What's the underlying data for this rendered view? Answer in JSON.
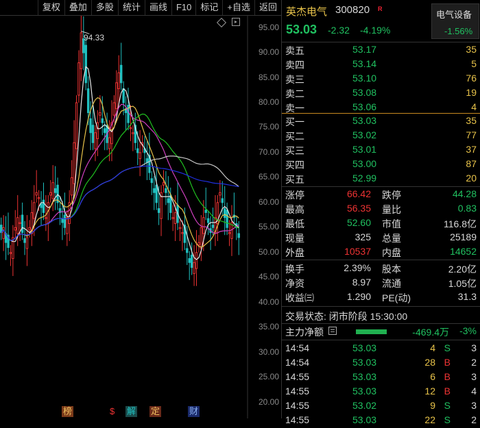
{
  "toolbar": {
    "buttons": [
      "复权",
      "叠加",
      "多股",
      "统计",
      "画线",
      "F10",
      "标记",
      "+自选",
      "返回"
    ]
  },
  "chart": {
    "y_ticks": [
      "95.00",
      "90.00",
      "85.00",
      "80.00",
      "75.00",
      "70.00",
      "65.00",
      "60.00",
      "55.00",
      "50.00",
      "45.00",
      "40.00",
      "35.00",
      "30.00",
      "25.00",
      "20.00"
    ],
    "peak_label": "94.33",
    "badges": [
      "榜",
      "$",
      "解",
      "定",
      "财"
    ],
    "colors": {
      "up": "#ee3333",
      "down": "#20c0c0",
      "ma5": "#e8e8e8",
      "ma10": "#e8c34a",
      "ma20": "#d040c0",
      "ma30": "#20c020",
      "ma60": "#c8c8c8",
      "ma120": "#2030e0"
    }
  },
  "chart_data": {
    "type": "candlestick",
    "ylim": [
      20,
      97
    ],
    "peak": 94.33,
    "series": [
      {
        "values": [
          54,
          55,
          52,
          51,
          50,
          53,
          55,
          57,
          56,
          54,
          52,
          53,
          55,
          58,
          60,
          62,
          61,
          59,
          58,
          57,
          60,
          62,
          64,
          62,
          60,
          58,
          56,
          55,
          57,
          60,
          65,
          72,
          80,
          88,
          94,
          90,
          84,
          78,
          74,
          72,
          74,
          76,
          78,
          76,
          74,
          72,
          73,
          76,
          80,
          84,
          86,
          84,
          80,
          78,
          76,
          75,
          74,
          72,
          70,
          70,
          72,
          70,
          68,
          66,
          64,
          62,
          60,
          58,
          62,
          64,
          62,
          60,
          58,
          57,
          58,
          56,
          55,
          54,
          52,
          50,
          48,
          47,
          48,
          50,
          52,
          55,
          57,
          58,
          56,
          54,
          55,
          57,
          60,
          62,
          60,
          57,
          55,
          54,
          56,
          57,
          55,
          53
        ]
      }
    ]
  },
  "quote": {
    "name": "英杰电气",
    "code": "300820",
    "rz": "R",
    "price": "53.03",
    "change": "-2.32",
    "pct": "-4.19%",
    "sector": "电气设备",
    "sector_pct": "-1.56%"
  },
  "orderbook": {
    "asks": [
      {
        "label": "卖五",
        "price": "53.17",
        "vol": "35"
      },
      {
        "label": "卖四",
        "price": "53.14",
        "vol": "5"
      },
      {
        "label": "卖三",
        "price": "53.10",
        "vol": "76"
      },
      {
        "label": "卖二",
        "price": "53.08",
        "vol": "19"
      },
      {
        "label": "卖一",
        "price": "53.06",
        "vol": "4"
      }
    ],
    "bids": [
      {
        "label": "买一",
        "price": "53.03",
        "vol": "35"
      },
      {
        "label": "买二",
        "price": "53.02",
        "vol": "77"
      },
      {
        "label": "买三",
        "price": "53.01",
        "vol": "37"
      },
      {
        "label": "买四",
        "price": "53.00",
        "vol": "87"
      },
      {
        "label": "买五",
        "price": "52.99",
        "vol": "20"
      }
    ]
  },
  "stats": {
    "zt_label": "涨停",
    "zt": "66.42",
    "dt_label": "跌停",
    "dt": "44.28",
    "high_label": "最高",
    "high": "56.35",
    "lb_label": "量比",
    "lb": "0.83",
    "low_label": "最低",
    "low": "52.60",
    "mv_label": "市值",
    "mv": "116.8亿",
    "xl_label": "现量",
    "xl": "325",
    "zl_label": "总量",
    "zl": "25189",
    "wp_label": "外盘",
    "wp": "10537",
    "np_label": "内盘",
    "np": "14652",
    "hs_label": "换手",
    "hs": "2.39%",
    "gb_label": "股本",
    "gb": "2.20亿",
    "jz_label": "净资",
    "jz": "8.97",
    "lt_label": "流通",
    "lt": "1.05亿",
    "sy_label": "收益㈢",
    "sy": "1.290",
    "pe_label": "PE(动)",
    "pe": "31.3"
  },
  "status": {
    "text": "交易状态: 闭市阶段 15:30:00"
  },
  "flow": {
    "label": "主力净额",
    "value": "-469.4万",
    "pct": "-3%"
  },
  "ticks": [
    {
      "time": "14:54",
      "price": "53.03",
      "vol": "4",
      "side": "S",
      "n": "3"
    },
    {
      "time": "14:54",
      "price": "53.03",
      "vol": "28",
      "side": "B",
      "n": "2"
    },
    {
      "time": "14:55",
      "price": "53.03",
      "vol": "6",
      "side": "B",
      "n": "3"
    },
    {
      "time": "14:55",
      "price": "53.03",
      "vol": "12",
      "side": "B",
      "n": "4"
    },
    {
      "time": "14:55",
      "price": "53.02",
      "vol": "9",
      "side": "S",
      "n": "3"
    },
    {
      "time": "14:55",
      "price": "53.03",
      "vol": "22",
      "side": "S",
      "n": "2"
    }
  ]
}
